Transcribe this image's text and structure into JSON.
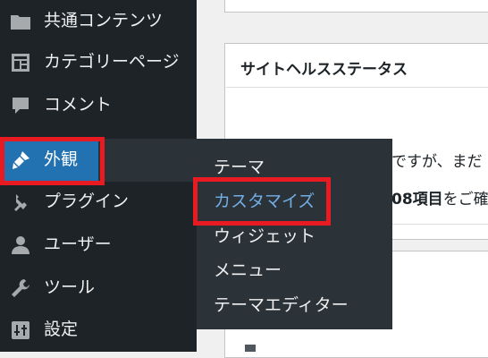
{
  "sidebar": {
    "items": [
      {
        "label": "共通コンテンツ",
        "icon": "folder-icon"
      },
      {
        "label": "カテゴリーページ",
        "icon": "layout-icon"
      },
      {
        "label": "コメント",
        "icon": "comment-icon"
      },
      {
        "label": "外観",
        "icon": "brush-icon"
      },
      {
        "label": "プラグイン",
        "icon": "plugin-icon"
      },
      {
        "label": "ユーザー",
        "icon": "user-icon"
      },
      {
        "label": "ツール",
        "icon": "wrench-icon"
      },
      {
        "label": "設定",
        "icon": "settings-icon"
      }
    ]
  },
  "flyout": {
    "items": [
      "テーマ",
      "カスタマイズ",
      "ウィジェット",
      "メニュー",
      "テーマエディター"
    ]
  },
  "main": {
    "site_health_title": "サイトヘルスステータス",
    "text_line1": "ですが、まだ",
    "text_line2_count": "08項目",
    "text_line2_rest": "をご確"
  },
  "colors": {
    "sidebar_bg": "#1d2327",
    "flyout_bg": "#2c3338",
    "active_bg": "#2271b1",
    "highlight_border": "#e81b23",
    "submenu_current": "#72aee6"
  }
}
